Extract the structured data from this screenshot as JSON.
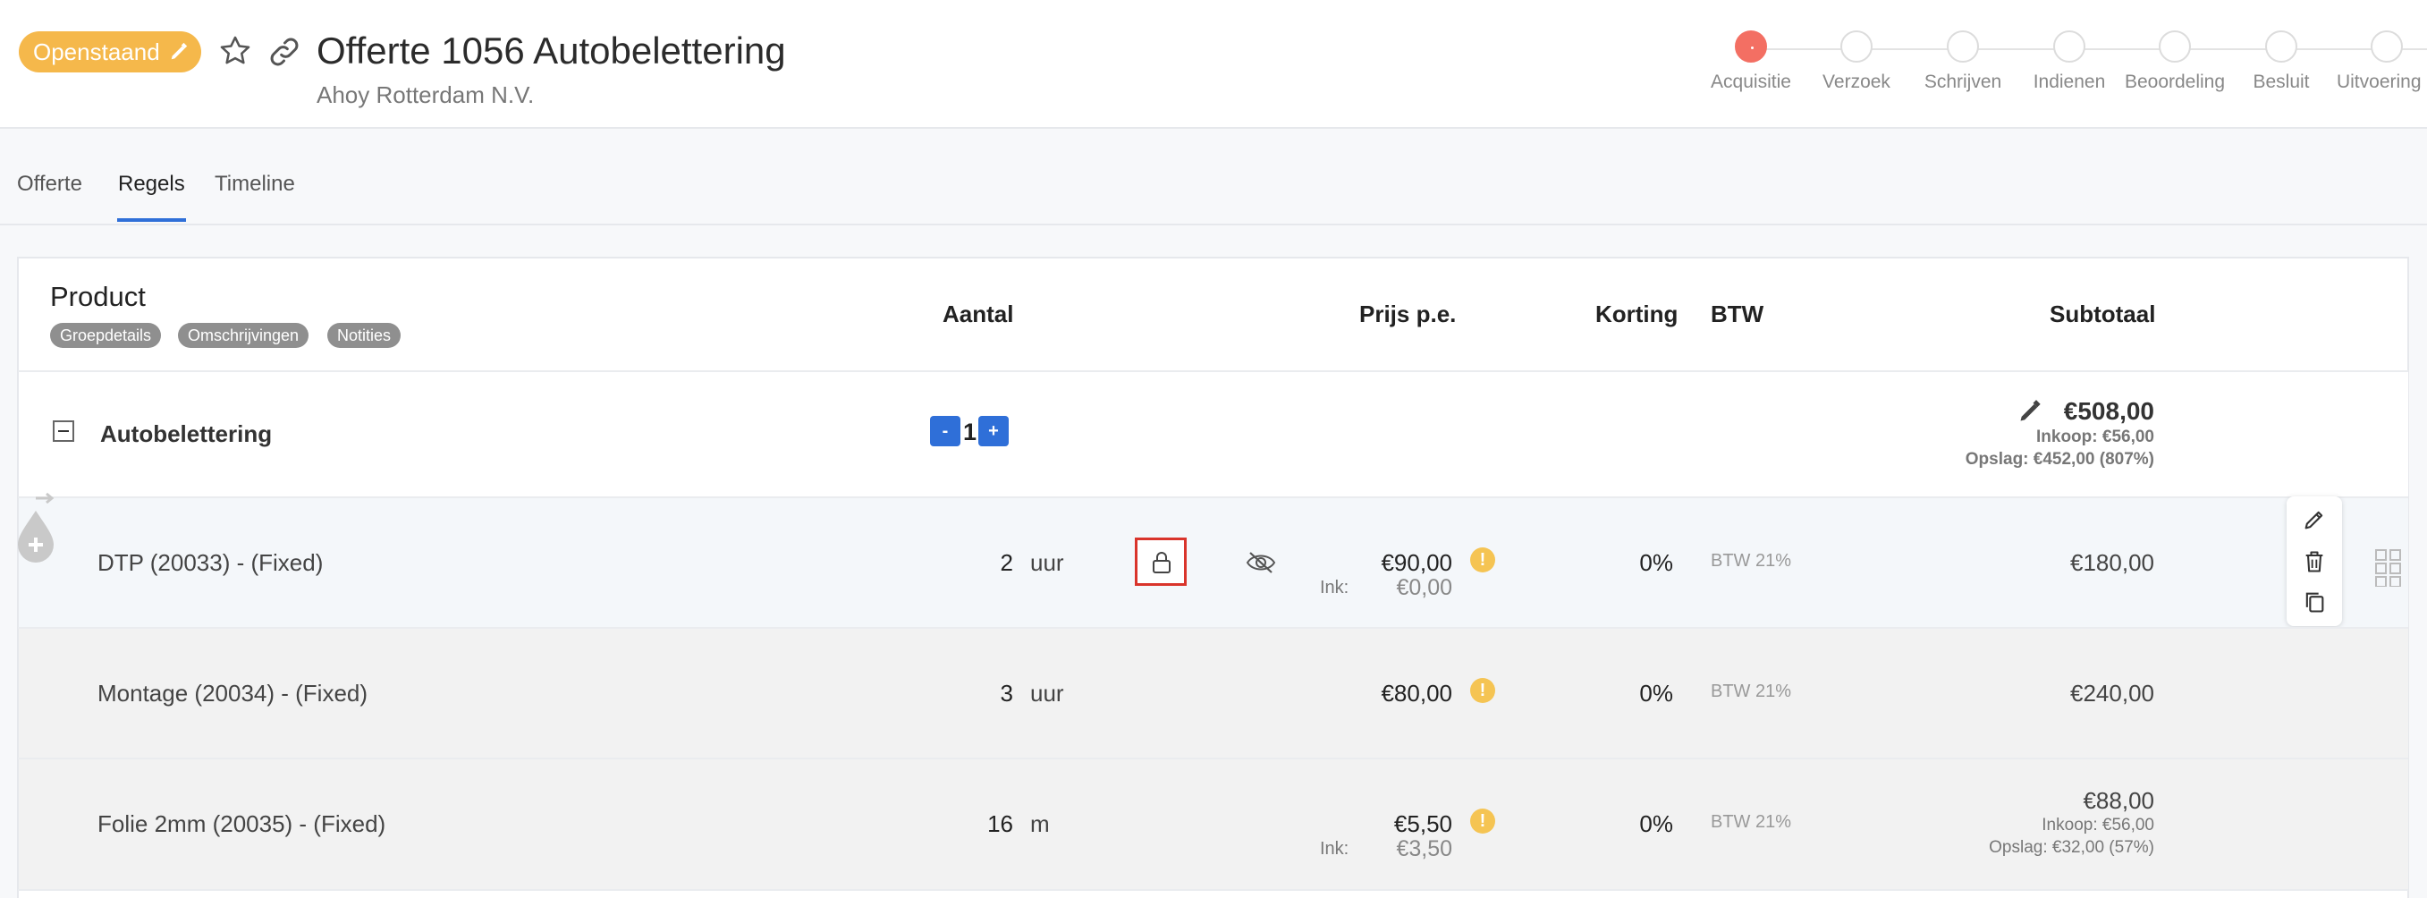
{
  "header": {
    "status_label": "Openstaand",
    "title": "Offerte 1056 Autobelettering",
    "subtitle": "Ahoy Rotterdam N.V.",
    "steps": [
      "Acquisitie",
      "Verzoek",
      "Schrijven",
      "Indienen",
      "Beoordeling",
      "Besluit",
      "Uitvoering o"
    ],
    "active_step": "Acquisitie"
  },
  "tabs": [
    "Offerte",
    "Regels",
    "Timeline"
  ],
  "active_tab": "Regels",
  "table": {
    "headers": {
      "product": "Product",
      "aantal": "Aantal",
      "prijs": "Prijs p.e.",
      "korting": "Korting",
      "btw": "BTW",
      "subtotaal": "Subtotaal"
    },
    "pills": [
      "Groepdetails",
      "Omschrijvingen",
      "Notities"
    ],
    "group": {
      "name": "Autobelettering",
      "qty": "1",
      "minus": "-",
      "plus": "+",
      "subtotal": "€508,00",
      "inkoop": "Inkoop: €56,00",
      "opslag": "Opslag: €452,00 (807%)"
    },
    "rows": [
      {
        "product": "DTP (20033) -  (Fixed)",
        "qty": "2",
        "unit": "uur",
        "price": "€90,00",
        "ink_label": "Ink:",
        "ink_value": "€0,00",
        "korting": "0%",
        "btw": "BTW 21%",
        "subtotal": "€180,00"
      },
      {
        "product": "Montage (20034) -  (Fixed)",
        "qty": "3",
        "unit": "uur",
        "price": "€80,00",
        "korting": "0%",
        "btw": "BTW 21%",
        "subtotal": "€240,00"
      },
      {
        "product": "Folie 2mm (20035) -  (Fixed)",
        "qty": "16",
        "unit": "m",
        "price": "€5,50",
        "ink_label": "Ink:",
        "ink_value": "€3,50",
        "korting": "0%",
        "btw": "BTW 21%",
        "subtotal": "€88,00",
        "inkoop": "Inkoop: €56,00",
        "opslag": "Opslag: €32,00 (57%)"
      }
    ],
    "warning_symbol": "!"
  },
  "colors": {
    "status": "#f5b84b",
    "accent": "#2f6fd8",
    "active_step": "#f36f63",
    "highlight": "#d9342b"
  },
  "icons": [
    "pencil-icon",
    "star-icon",
    "link-icon",
    "lock-icon",
    "eye-off-icon",
    "warning-icon",
    "edit-icon",
    "trash-icon",
    "copy-icon",
    "grid-icon",
    "add-row-icon"
  ]
}
